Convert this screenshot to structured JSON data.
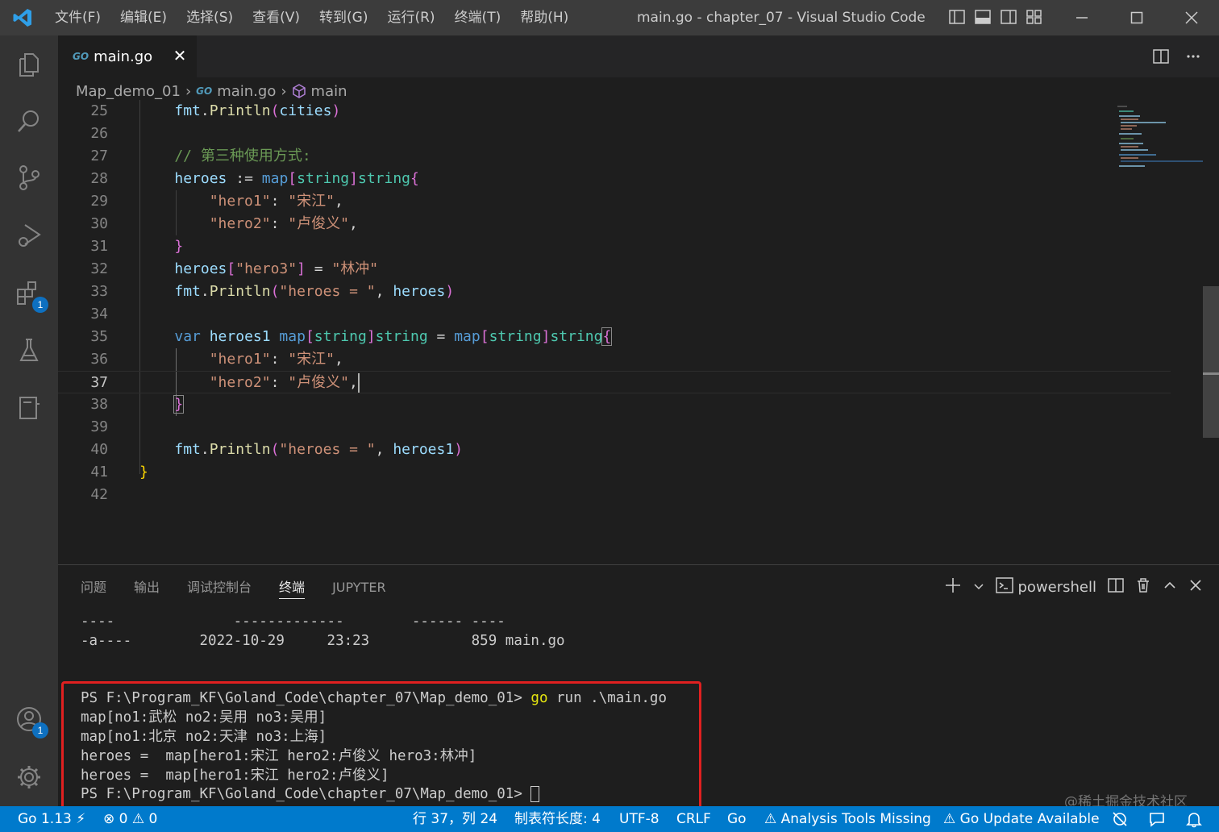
{
  "titlebar": {
    "menu": [
      "文件(F)",
      "编辑(E)",
      "选择(S)",
      "查看(V)",
      "转到(G)",
      "运行(R)",
      "终端(T)",
      "帮助(H)"
    ],
    "window_title": "main.go - chapter_07 - Visual Studio Code"
  },
  "activitybar": {
    "extensions_badge": "1",
    "accounts_badge": "1"
  },
  "tab": {
    "icon_text": "GO",
    "label": "main.go",
    "close": "✕"
  },
  "breadcrumb": {
    "folder": "Map_demo_01",
    "file_icon": "GO",
    "file": "main.go",
    "symbol": "main"
  },
  "editor": {
    "current_line": 37,
    "line_numbers": [
      "25",
      "26",
      "27",
      "28",
      "29",
      "30",
      "31",
      "32",
      "33",
      "34",
      "35",
      "36",
      "37",
      "38",
      "39",
      "40",
      "41",
      "42"
    ],
    "lines": [
      "    fmt.Println(cities)",
      "",
      "    // 第三种使用方式:",
      "    heroes := map[string]string{",
      "        \"hero1\": \"宋江\",",
      "        \"hero2\": \"卢俊义\",",
      "    }",
      "    heroes[\"hero3\"] = \"林冲\"",
      "    fmt.Println(\"heroes = \", heroes)",
      "",
      "    var heroes1 map[string]string = map[string]string{",
      "        \"hero1\": \"宋江\",",
      "        \"hero2\": \"卢俊义\",",
      "    }",
      "",
      "    fmt.Println(\"heroes = \", heroes1)",
      "}",
      ""
    ]
  },
  "panel": {
    "tabs": [
      "问题",
      "输出",
      "调试控制台",
      "终端",
      "JUPYTER"
    ],
    "active_tab": "终端",
    "shell_label": "powershell",
    "terminal_lines": [
      "----              -------------        ------ ----",
      "-a----        2022-10-29     23:23            859 main.go",
      "",
      "PS F:\\Program_KF\\Goland_Code\\chapter_07\\Map_demo_01> ",
      "map[no1:武松 no2:吴用 no3:吴用]",
      "map[no1:北京 no2:天津 no3:上海]",
      "heroes =  map[hero1:宋江 hero2:卢俊义 hero3:林冲]",
      "heroes =  map[hero1:宋江 hero2:卢俊义]",
      "PS F:\\Program_KF\\Goland_Code\\chapter_07\\Map_demo_01> "
    ],
    "command_go": "go",
    "command_rest": " run .\\main.go"
  },
  "statusbar": {
    "go_version": "Go 1.13",
    "errors": "0",
    "warnings": "0",
    "position": "行 37，列 24",
    "tab_size": "制表符长度: 4",
    "encoding": "UTF-8",
    "eol": "CRLF",
    "language": "Go",
    "analysis_tools": "Analysis Tools Missing",
    "go_update": "Go Update Available"
  },
  "watermark": "@稀土掘金技术社区",
  "colors": {
    "titlebar": "#3c3c3c",
    "activitybar": "#333333",
    "editor_bg": "#1e1e1e",
    "statusbar": "#007acc",
    "highlight_box": "#e02020"
  }
}
